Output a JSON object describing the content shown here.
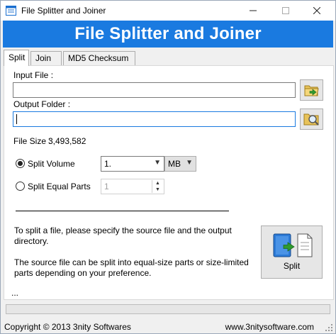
{
  "window": {
    "title": "File Splitter and Joiner",
    "minimize_glyph": "—",
    "maximize_glyph": "☐",
    "close_glyph": "✕"
  },
  "banner": {
    "title": "File Splitter and Joiner",
    "color": "#1a7ae0"
  },
  "tabs": [
    {
      "label": "Split",
      "active": true
    },
    {
      "label": "Join",
      "active": false
    },
    {
      "label": "MD5 Checksum",
      "active": false
    }
  ],
  "split": {
    "input_file_label": "Input File :",
    "input_file_value": "",
    "output_folder_label": "Output Folder :",
    "output_folder_value": "",
    "file_size_label": "File Size :",
    "file_size_value": "3,493,582",
    "split_volume_label": "Split Volume",
    "split_volume_selected": true,
    "split_volume_value": "1.",
    "split_volume_unit": "MB",
    "split_equal_label": "Split Equal Parts",
    "split_equal_value": "1",
    "description_1": "To split a file, please specify the source file and the output directory.",
    "description_2": "The source file can be split into equal-size parts or size-limited parts depending on your preference.",
    "split_button_label": "Split",
    "ellipsis": "..."
  },
  "progress": {
    "value": 0
  },
  "status": {
    "copyright": "Copyright © 2013 3nity Softwares",
    "website": "www.3nitysoftware.com"
  }
}
